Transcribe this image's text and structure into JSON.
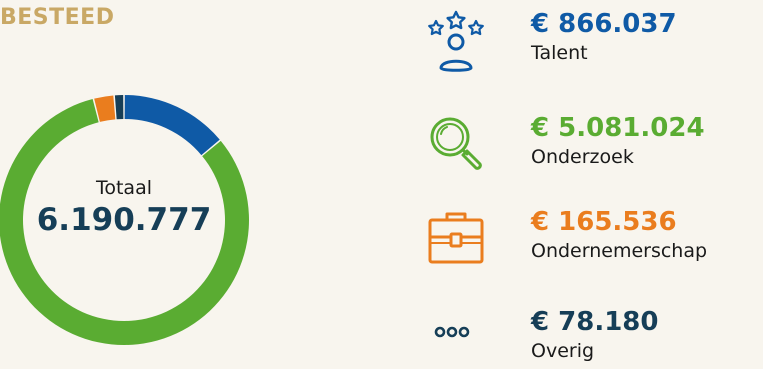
{
  "colors": {
    "talent": "#0f5aa6",
    "onderzoek": "#5aac32",
    "ondernemerschap": "#ea7d1e",
    "overig": "#163e57",
    "title": "#c9a865",
    "total_value": "#163e57",
    "background": "#f8f5ee"
  },
  "title": "BESTEED",
  "total": {
    "label": "Totaal",
    "value": "6.190.777"
  },
  "legend": [
    {
      "icon": "talent-stars-person-icon",
      "value": "€ 866.037",
      "label": "Talent"
    },
    {
      "icon": "magnifier-icon",
      "value": "€ 5.081.024",
      "label": "Onderzoek"
    },
    {
      "icon": "toolbox-icon",
      "value": "€ 165.536",
      "label": "Ondernemerschap"
    },
    {
      "icon": "three-dots-icon",
      "value": "€ 78.180",
      "label": "Overig"
    }
  ],
  "chart_data": {
    "type": "pie",
    "donut": true,
    "categories": [
      "Talent",
      "Onderzoek",
      "Ondernemerschap",
      "Overig"
    ],
    "values": [
      866037,
      5081024,
      165536,
      78180
    ],
    "total": 6190777,
    "title": "BESTEED"
  }
}
